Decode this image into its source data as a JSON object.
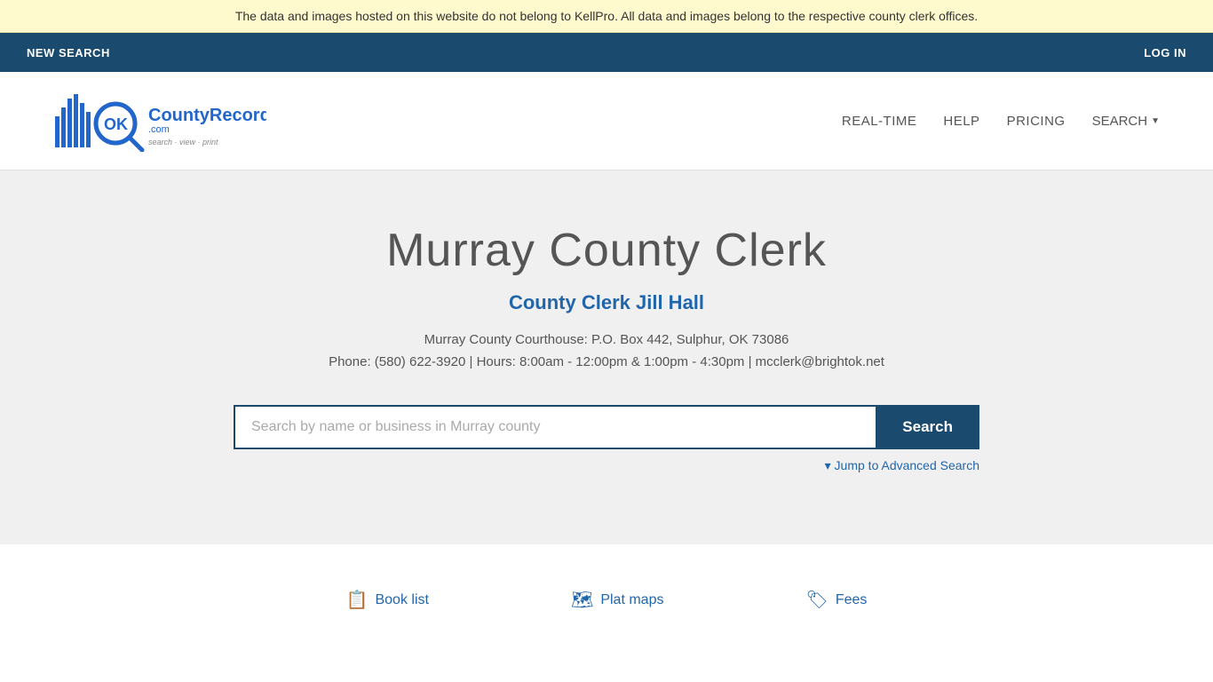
{
  "banner": {
    "text": "The data and images hosted on this website do not belong to KellPro. All data and images belong to the respective county clerk offices."
  },
  "navbar": {
    "new_search_label": "NEW SEARCH",
    "login_label": "LOG IN"
  },
  "header": {
    "logo_alt": "OKCountyRecords.com",
    "logo_tagline": "search · view · print",
    "nav_items": [
      {
        "label": "REAL-TIME",
        "id": "real-time"
      },
      {
        "label": "HELP",
        "id": "help"
      },
      {
        "label": "PRICING",
        "id": "pricing"
      },
      {
        "label": "SEARCH",
        "id": "search",
        "has_dropdown": true
      }
    ]
  },
  "main": {
    "county_title": "Murray County Clerk",
    "clerk_name": "County Clerk Jill Hall",
    "address": "Murray County Courthouse: P.O. Box 442, Sulphur, OK 73086",
    "contact": "Phone: (580) 622-3920 | Hours: 8:00am - 12:00pm & 1:00pm - 4:30pm | mcclerk@brightok.net",
    "search_placeholder": "Search by name or business in Murray county",
    "search_button_label": "Search",
    "advanced_search_label": "▾ Jump to Advanced Search"
  },
  "footer_links": [
    {
      "label": "Book list",
      "icon": "📋",
      "id": "book-list"
    },
    {
      "label": "Plat maps",
      "icon": "🗺",
      "id": "plat-maps"
    },
    {
      "label": "Fees",
      "icon": "🏷",
      "id": "fees"
    }
  ],
  "colors": {
    "accent_blue": "#2266aa",
    "nav_bg": "#1a4a6e",
    "banner_bg": "#fffacd",
    "main_bg": "#f0f0f0"
  }
}
